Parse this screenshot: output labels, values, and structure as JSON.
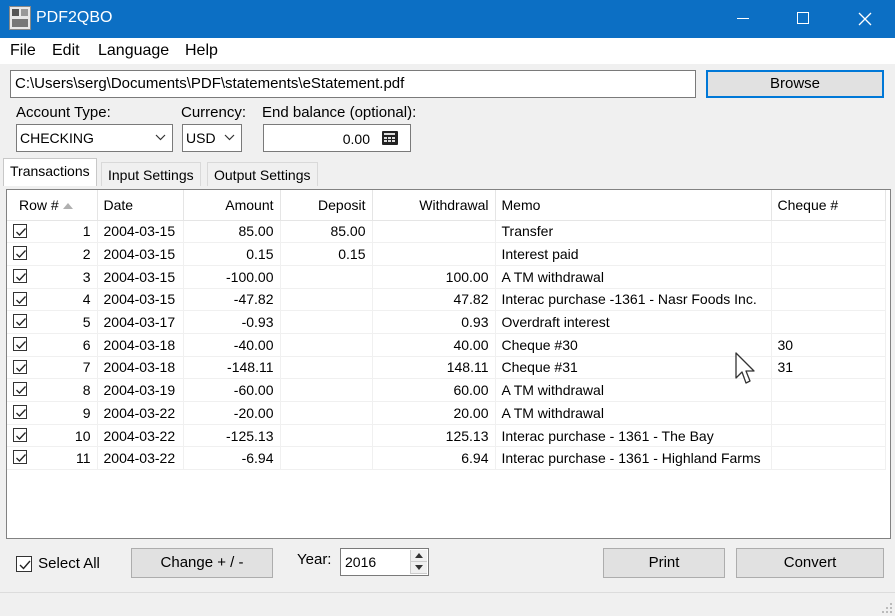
{
  "window": {
    "title": "PDF2QBO"
  },
  "menu": [
    "File",
    "Edit",
    "Language",
    "Help"
  ],
  "file_path": "C:\\Users\\serg\\Documents\\PDF\\statements\\eStatement.pdf",
  "browse_label": "Browse",
  "account_type": {
    "label": "Account Type:",
    "value": "CHECKING"
  },
  "currency": {
    "label": "Currency:",
    "value": "USD"
  },
  "end_balance": {
    "label": "End balance (optional):",
    "value": "0.00"
  },
  "tabs": [
    "Transactions",
    "Input Settings",
    "Output Settings"
  ],
  "columns": [
    "Row #",
    "Date",
    "Amount",
    "Deposit",
    "Withdrawal",
    "Memo",
    "Cheque #"
  ],
  "rows": [
    {
      "checked": true,
      "row": "1",
      "date": "2004-03-15",
      "amount": "85.00",
      "deposit": "85.00",
      "withdrawal": "",
      "memo": "Transfer",
      "cheque": ""
    },
    {
      "checked": true,
      "row": "2",
      "date": "2004-03-15",
      "amount": "0.15",
      "deposit": "0.15",
      "withdrawal": "",
      "memo": "Interest paid",
      "cheque": ""
    },
    {
      "checked": true,
      "row": "3",
      "date": "2004-03-15",
      "amount": "-100.00",
      "deposit": "",
      "withdrawal": "100.00",
      "memo": "A TM withdrawal",
      "cheque": ""
    },
    {
      "checked": true,
      "row": "4",
      "date": "2004-03-15",
      "amount": "-47.82",
      "deposit": "",
      "withdrawal": "47.82",
      "memo": "Interac purchase -1361 - Nasr Foods Inc.",
      "cheque": ""
    },
    {
      "checked": true,
      "row": "5",
      "date": "2004-03-17",
      "amount": "-0.93",
      "deposit": "",
      "withdrawal": "0.93",
      "memo": "Overdraft interest",
      "cheque": ""
    },
    {
      "checked": true,
      "row": "6",
      "date": "2004-03-18",
      "amount": "-40.00",
      "deposit": "",
      "withdrawal": "40.00",
      "memo": "Cheque #30",
      "cheque": "30"
    },
    {
      "checked": true,
      "row": "7",
      "date": "2004-03-18",
      "amount": "-148.11",
      "deposit": "",
      "withdrawal": "148.11",
      "memo": "Cheque #31",
      "cheque": "31"
    },
    {
      "checked": true,
      "row": "8",
      "date": "2004-03-19",
      "amount": "-60.00",
      "deposit": "",
      "withdrawal": "60.00",
      "memo": "A TM withdrawal",
      "cheque": ""
    },
    {
      "checked": true,
      "row": "9",
      "date": "2004-03-22",
      "amount": "-20.00",
      "deposit": "",
      "withdrawal": "20.00",
      "memo": "A TM withdrawal",
      "cheque": ""
    },
    {
      "checked": true,
      "row": "10",
      "date": "2004-03-22",
      "amount": "-125.13",
      "deposit": "",
      "withdrawal": "125.13",
      "memo": "Interac purchase - 1361 - The Bay",
      "cheque": ""
    },
    {
      "checked": true,
      "row": "11",
      "date": "2004-03-22",
      "amount": "-6.94",
      "deposit": "",
      "withdrawal": "6.94",
      "memo": "Interac purchase - 1361 - Highland Farms",
      "cheque": ""
    }
  ],
  "bottom": {
    "select_all_label": "Select All",
    "select_all_checked": true,
    "change_sign_label": "Change + / -",
    "year_label": "Year:",
    "year_value": "2016",
    "print_label": "Print",
    "convert_label": "Convert"
  },
  "colors": {
    "titlebar": "#0c6fc4",
    "focus_border": "#0078d7"
  }
}
